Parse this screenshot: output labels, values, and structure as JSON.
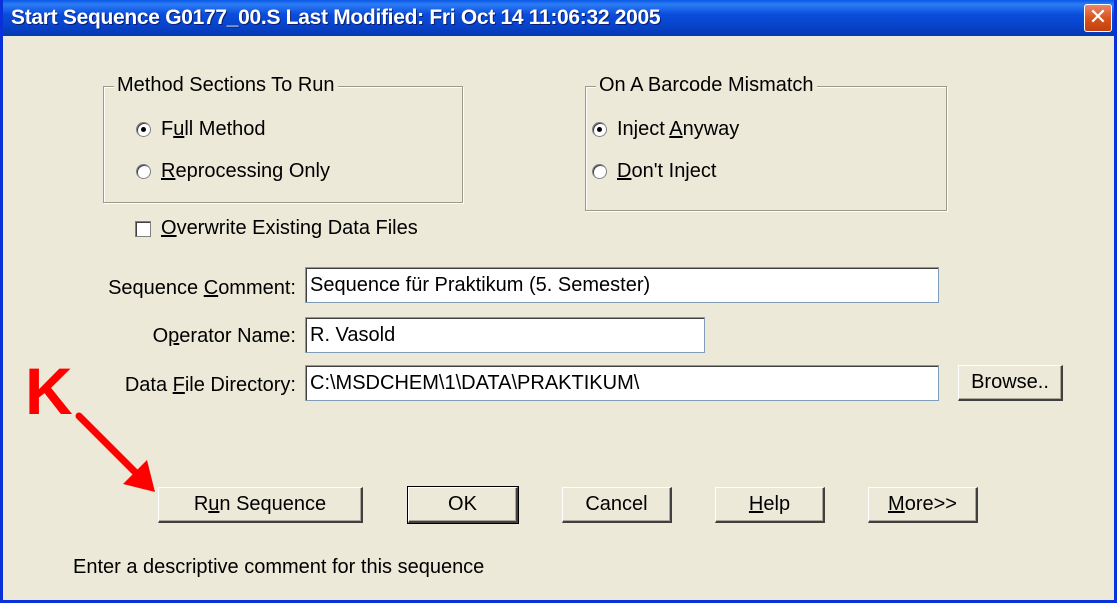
{
  "window": {
    "title": "Start Sequence G0177_00.S  Last Modified: Fri Oct 14 11:06:32 2005",
    "close_glyph": "✕"
  },
  "method_sections": {
    "label": "Method Sections To Run",
    "options": [
      {
        "pre": "F",
        "u": "u",
        "post": "ll Method",
        "checked": true
      },
      {
        "pre": "",
        "u": "R",
        "post": "eprocessing Only",
        "checked": false
      }
    ]
  },
  "barcode_mismatch": {
    "label": "On A Barcode Mismatch",
    "options": [
      {
        "pre": "Inject ",
        "u": "A",
        "post": "nyway",
        "checked": true
      },
      {
        "pre": "",
        "u": "D",
        "post": "on't Inject",
        "checked": false
      }
    ]
  },
  "overwrite": {
    "pre": "",
    "u": "O",
    "post": "verwrite Existing Data Files",
    "checked": false
  },
  "fields": {
    "comment": {
      "pre": "Sequence ",
      "u": "C",
      "post": "omment:",
      "value": "Sequence für Praktikum (5. Semester)"
    },
    "operator": {
      "pre": "O",
      "u": "p",
      "post": "erator Name:",
      "value": "R. Vasold"
    },
    "directory": {
      "pre": "Data ",
      "u": "F",
      "post": "ile Directory:",
      "value": "C:\\MSDCHEM\\1\\DATA\\PRAKTIKUM\\"
    }
  },
  "buttons": {
    "browse": "Browse..",
    "run": {
      "pre": "R",
      "u": "u",
      "post": "n Sequence"
    },
    "ok": "OK",
    "cancel": "Cancel",
    "help": {
      "pre": "",
      "u": "H",
      "post": "elp"
    },
    "more": {
      "pre": "",
      "u": "M",
      "post": "ore>>"
    }
  },
  "status_text": "Enter a descriptive comment for this sequence",
  "annotation": {
    "letter": "K",
    "color": "#ff0000"
  }
}
